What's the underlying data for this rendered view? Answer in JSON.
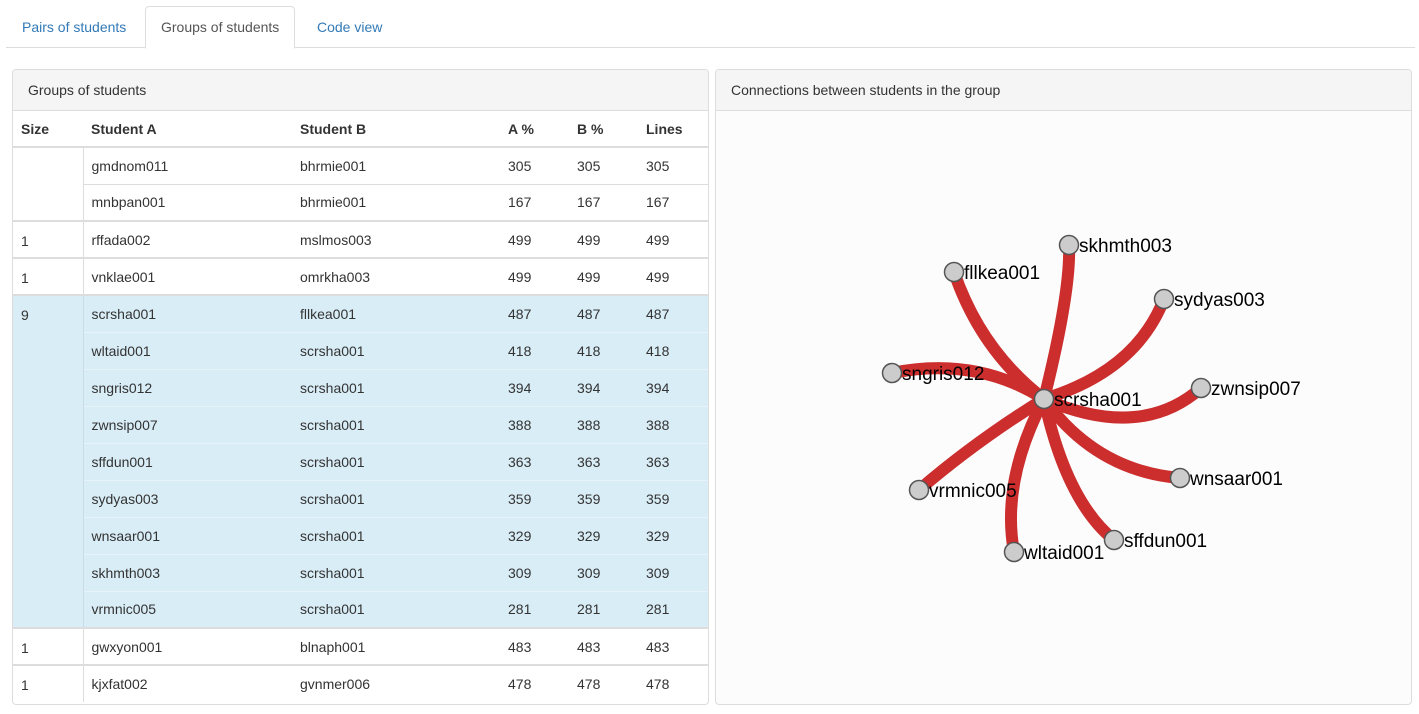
{
  "tabs": [
    {
      "label": "Pairs of students",
      "active": false
    },
    {
      "label": "Groups of students",
      "active": true
    },
    {
      "label": "Code view",
      "active": false
    }
  ],
  "left_panel": {
    "title": "Groups of students",
    "columns": [
      "Size",
      "Student A",
      "Student B",
      "A %",
      "B %",
      "Lines"
    ],
    "groups": [
      {
        "size": "",
        "rows": [
          {
            "a": "gmdnom011",
            "b": "bhrmie001",
            "ap": "305",
            "bp": "305",
            "lines": "305"
          },
          {
            "a": "mnbpan001",
            "b": "bhrmie001",
            "ap": "167",
            "bp": "167",
            "lines": "167"
          }
        ]
      },
      {
        "size": "1",
        "rows": [
          {
            "a": "rffada002",
            "b": "mslmos003",
            "ap": "499",
            "bp": "499",
            "lines": "499"
          }
        ]
      },
      {
        "size": "1",
        "rows": [
          {
            "a": "vnklae001",
            "b": "omrkha003",
            "ap": "499",
            "bp": "499",
            "lines": "499"
          }
        ]
      },
      {
        "size": "9",
        "selected": true,
        "rows": [
          {
            "a": "scrsha001",
            "b": "fllkea001",
            "ap": "487",
            "bp": "487",
            "lines": "487"
          },
          {
            "a": "wltaid001",
            "b": "scrsha001",
            "ap": "418",
            "bp": "418",
            "lines": "418"
          },
          {
            "a": "sngris012",
            "b": "scrsha001",
            "ap": "394",
            "bp": "394",
            "lines": "394"
          },
          {
            "a": "zwnsip007",
            "b": "scrsha001",
            "ap": "388",
            "bp": "388",
            "lines": "388"
          },
          {
            "a": "sffdun001",
            "b": "scrsha001",
            "ap": "363",
            "bp": "363",
            "lines": "363"
          },
          {
            "a": "sydyas003",
            "b": "scrsha001",
            "ap": "359",
            "bp": "359",
            "lines": "359"
          },
          {
            "a": "wnsaar001",
            "b": "scrsha001",
            "ap": "329",
            "bp": "329",
            "lines": "329"
          },
          {
            "a": "skhmth003",
            "b": "scrsha001",
            "ap": "309",
            "bp": "309",
            "lines": "309"
          },
          {
            "a": "vrmnic005",
            "b": "scrsha001",
            "ap": "281",
            "bp": "281",
            "lines": "281"
          }
        ]
      },
      {
        "size": "1",
        "rows": [
          {
            "a": "gwxyon001",
            "b": "blnaph001",
            "ap": "483",
            "bp": "483",
            "lines": "483"
          }
        ]
      },
      {
        "size": "1",
        "rows": [
          {
            "a": "kjxfat002",
            "b": "gvnmer006",
            "ap": "478",
            "bp": "478",
            "lines": "478"
          }
        ]
      }
    ]
  },
  "right_panel": {
    "title": "Connections between students in the group",
    "center_node": "scrsha001",
    "nodes": [
      "skhmth003",
      "fllkea001",
      "sydyas003",
      "sngris012",
      "zwnsip007",
      "wnsaar001",
      "vrmnic005",
      "sffdun001",
      "wltaid001"
    ]
  },
  "colors": {
    "edge": "#cc2e2e",
    "node_fill": "#cccccc",
    "node_stroke": "#555555",
    "link": "#337ab7",
    "selected_row": "#d9edf7"
  },
  "icons": []
}
